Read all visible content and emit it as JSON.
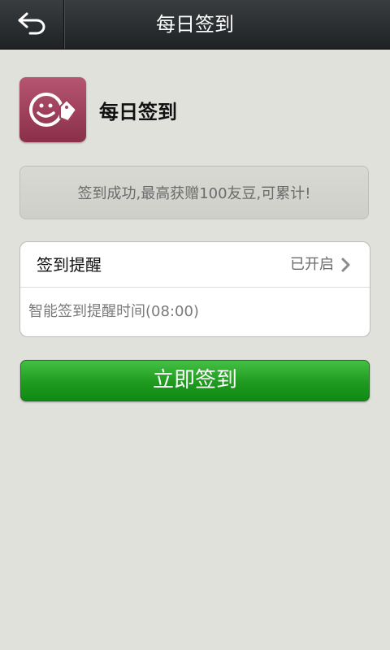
{
  "topbar": {
    "title": "每日签到",
    "back_icon": "back-arrow-icon"
  },
  "header": {
    "app_title": "每日签到",
    "app_icon": "smiley-tag-icon"
  },
  "notice": {
    "text": "签到成功,最高获赠100友豆,可累计!"
  },
  "reminder": {
    "label": "签到提醒",
    "status": "已开启",
    "chevron_icon": "chevron-right-icon",
    "subtext": "智能签到提醒时间(08:00)"
  },
  "checkin_button": {
    "label": "立即签到"
  },
  "colors": {
    "background": "#e1e1dc",
    "topbar": "#2a2d2f",
    "app_icon": "#a1415e",
    "button_green": "#1f9a1f"
  }
}
